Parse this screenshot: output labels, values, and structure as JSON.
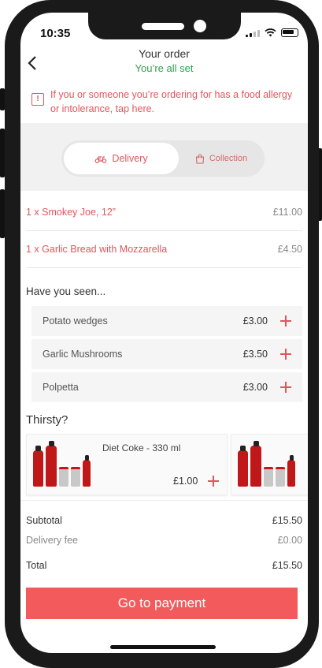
{
  "status_bar": {
    "time": "10:35"
  },
  "header": {
    "title": "Your order",
    "subtitle": "You’re all set"
  },
  "allergy_notice": "If you or someone you’re ordering for has a food allergy or intolerance, tap here.",
  "fulfilment_toggle": {
    "delivery_label": "Delivery",
    "collection_label": "Collection",
    "selected": "Delivery"
  },
  "order_items": [
    {
      "label": "1 x Smokey Joe, 12”",
      "price": "£11.00"
    },
    {
      "label": "1 x Garlic Bread with Mozzarella",
      "price": "£4.50"
    }
  ],
  "suggestions": {
    "title": "Have you seen...",
    "items": [
      {
        "name": "Potato wedges",
        "price": "£3.00"
      },
      {
        "name": "Garlic Mushrooms",
        "price": "£3.50"
      },
      {
        "name": "Polpetta",
        "price": "£3.00"
      }
    ]
  },
  "drinks": {
    "title": "Thirsty?",
    "items": [
      {
        "name": "Diet Coke - 330 ml",
        "price": "£1.00"
      }
    ]
  },
  "totals": {
    "subtotal_label": "Subtotal",
    "subtotal_value": "£15.50",
    "delivery_label": "Delivery fee",
    "delivery_value": "£0.00",
    "total_label": "Total",
    "total_value": "£15.50"
  },
  "cta": {
    "label": "Go to payment"
  },
  "colors": {
    "accent": "#e0565d",
    "button": "#f25a5c",
    "success": "#2e9e4a"
  }
}
